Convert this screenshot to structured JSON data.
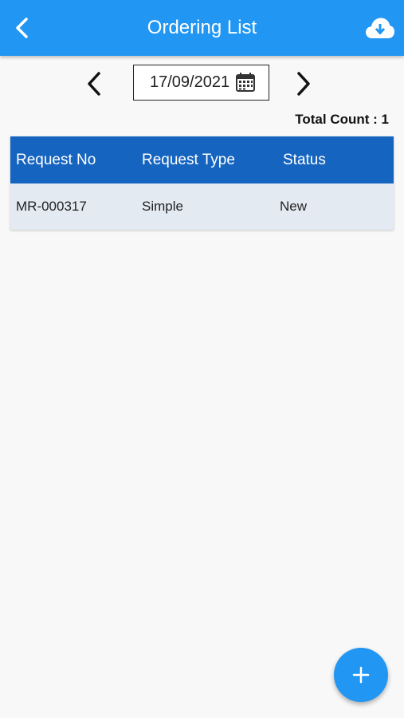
{
  "header": {
    "title": "Ordering List",
    "back_icon": "chevron-left-icon",
    "action_icon": "cloud-download-icon",
    "color": "#2196f3"
  },
  "date_nav": {
    "date": "17/09/2021",
    "prev_icon": "chevron-left-icon",
    "next_icon": "chevron-right-icon",
    "calendar_icon": "calendar-icon"
  },
  "total_count": "Total Count : 1",
  "table": {
    "header_color": "#1565c0",
    "columns": [
      "Request No",
      "Request Type",
      "Status"
    ],
    "rows": [
      [
        "MR-000317",
        "Simple",
        "New"
      ]
    ]
  },
  "fab": {
    "icon": "plus-icon",
    "color": "#2196f3"
  }
}
